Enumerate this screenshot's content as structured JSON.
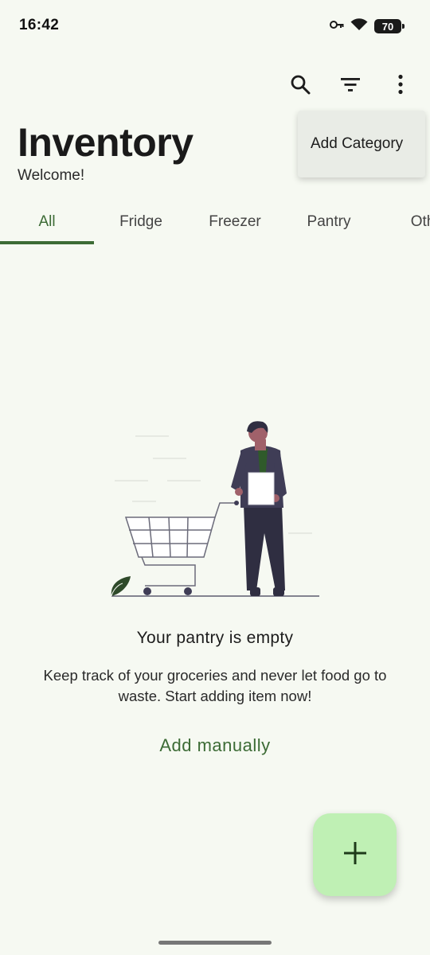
{
  "status_bar": {
    "time": "16:42",
    "battery": "70",
    "icons": [
      "key-icon",
      "wifi-icon",
      "battery-icon"
    ]
  },
  "toolbar": {
    "icons": [
      "search-icon",
      "filter-icon",
      "more-vert-icon"
    ]
  },
  "menu": {
    "items": [
      {
        "label": "Add Category"
      }
    ]
  },
  "header": {
    "title": "Inventory",
    "subtitle": "Welcome!"
  },
  "tabs": [
    {
      "label": "All",
      "active": true
    },
    {
      "label": "Fridge",
      "active": false
    },
    {
      "label": "Freezer",
      "active": false
    },
    {
      "label": "Pantry",
      "active": false
    },
    {
      "label": "Oth",
      "active": false
    }
  ],
  "empty_state": {
    "title": "Your pantry is empty",
    "body": "Keep track of your groceries and never let food go to waste. Start adding item now!",
    "action_label": "Add manually"
  },
  "fab": {
    "icon": "plus-icon"
  },
  "colors": {
    "background": "#f6f9f2",
    "accent": "#3c6b35",
    "fab": "#bff0b4",
    "menu": "#e9ece6"
  }
}
